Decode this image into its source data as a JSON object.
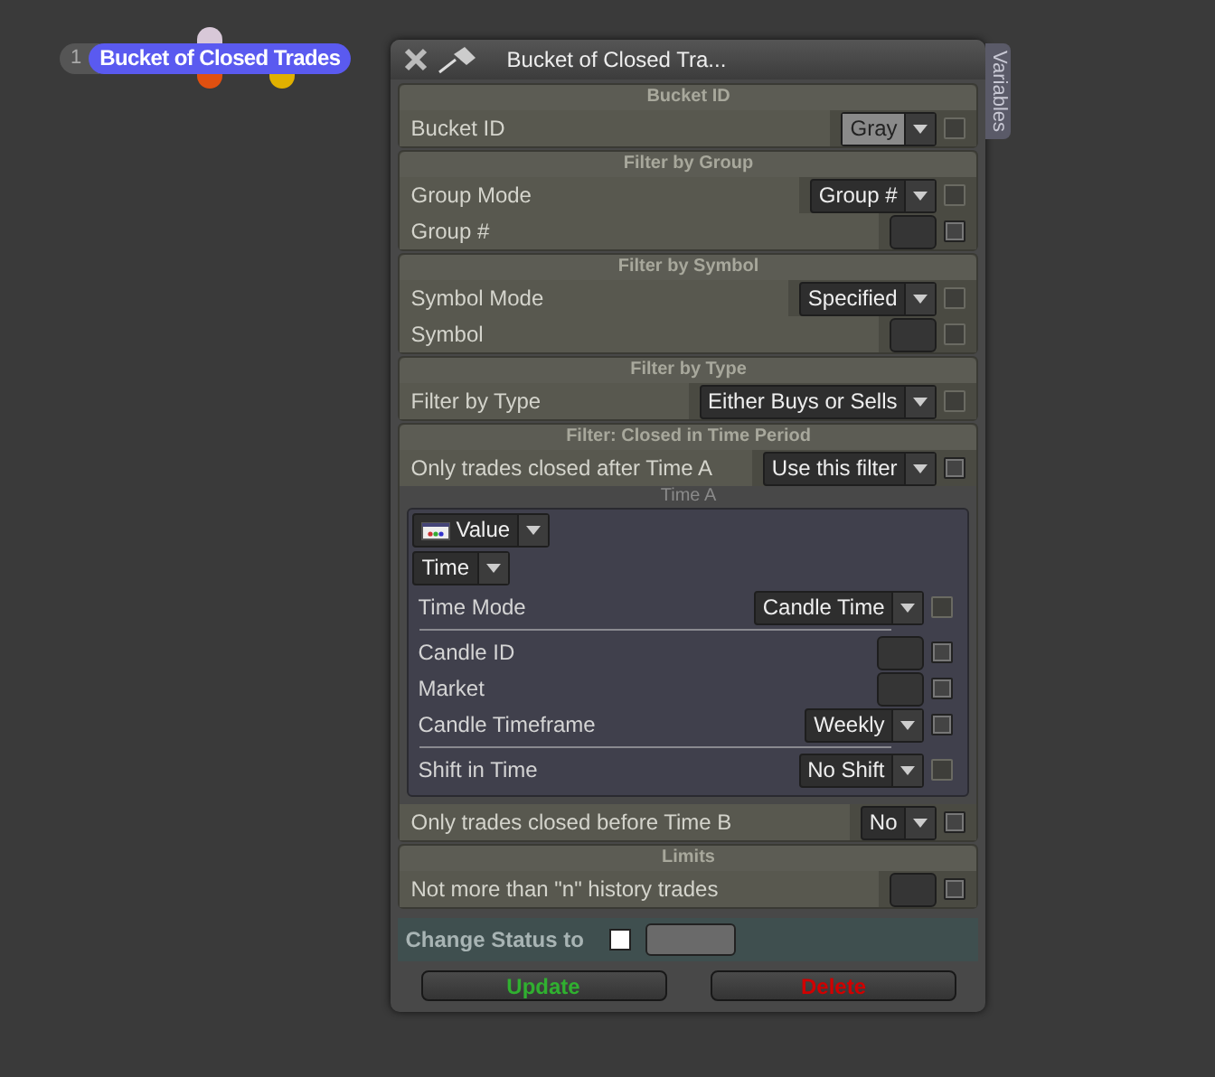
{
  "node": {
    "index": "1",
    "title": "Bucket of Closed Trades"
  },
  "panel": {
    "title": "Bucket of Closed Tra...",
    "side_tab": "Variables"
  },
  "sections": [
    {
      "header": "Bucket ID",
      "items": [
        {
          "kind": "color_dropdown",
          "label": "Bucket ID",
          "value": "Gray",
          "checked": false,
          "disabled": true
        }
      ]
    },
    {
      "header": "Filter by Group",
      "items": [
        {
          "kind": "dropdown",
          "label": "Group Mode",
          "value": "Group #",
          "checked": false,
          "disabled": true
        },
        {
          "kind": "box",
          "label": "Group #",
          "checked": false,
          "disabled": false
        }
      ]
    },
    {
      "header": "Filter by Symbol",
      "items": [
        {
          "kind": "dropdown",
          "label": "Symbol Mode",
          "value": "Specified",
          "checked": false,
          "disabled": true
        },
        {
          "kind": "box",
          "label": "Symbol",
          "checked": false,
          "disabled": true
        }
      ]
    },
    {
      "header": "Filter by Type",
      "items": [
        {
          "kind": "dropdown",
          "label": "Filter by Type",
          "value": "Either Buys or Sells",
          "checked": false,
          "disabled": true
        }
      ]
    },
    {
      "header": "Filter: Closed in Time Period",
      "items": [
        {
          "kind": "dropdown",
          "label": "Only trades closed after Time A",
          "value": "Use this filter",
          "checked": false,
          "disabled": false
        },
        {
          "kind": "time_block",
          "title": "Time A",
          "source": "Value",
          "type": "Time",
          "rows": [
            {
              "kind": "dropdown",
              "label": "Time Mode",
              "value": "Candle Time",
              "checked": false,
              "disabled": true
            },
            {
              "kind": "divider"
            },
            {
              "kind": "box",
              "label": "Candle ID",
              "checked": false,
              "disabled": false
            },
            {
              "kind": "box",
              "label": "Market",
              "checked": false,
              "disabled": false
            },
            {
              "kind": "dropdown",
              "label": "Candle Timeframe",
              "value": "Weekly",
              "checked": false,
              "disabled": false
            },
            {
              "kind": "divider"
            },
            {
              "kind": "dropdown",
              "label": "Shift in Time",
              "value": "No Shift",
              "checked": false,
              "disabled": true
            }
          ]
        },
        {
          "kind": "dropdown",
          "label": "Only trades closed before Time B",
          "value": "No",
          "checked": false,
          "disabled": false
        }
      ]
    },
    {
      "header": "Limits",
      "items": [
        {
          "kind": "box",
          "label": "Not more than \"n\" history trades",
          "checked": false,
          "disabled": false
        }
      ]
    }
  ],
  "status": {
    "label": "Change Status to",
    "checked": false
  },
  "buttons": [
    {
      "label": "Update",
      "kind": "update"
    },
    {
      "label": "Delete",
      "kind": "delete"
    }
  ]
}
